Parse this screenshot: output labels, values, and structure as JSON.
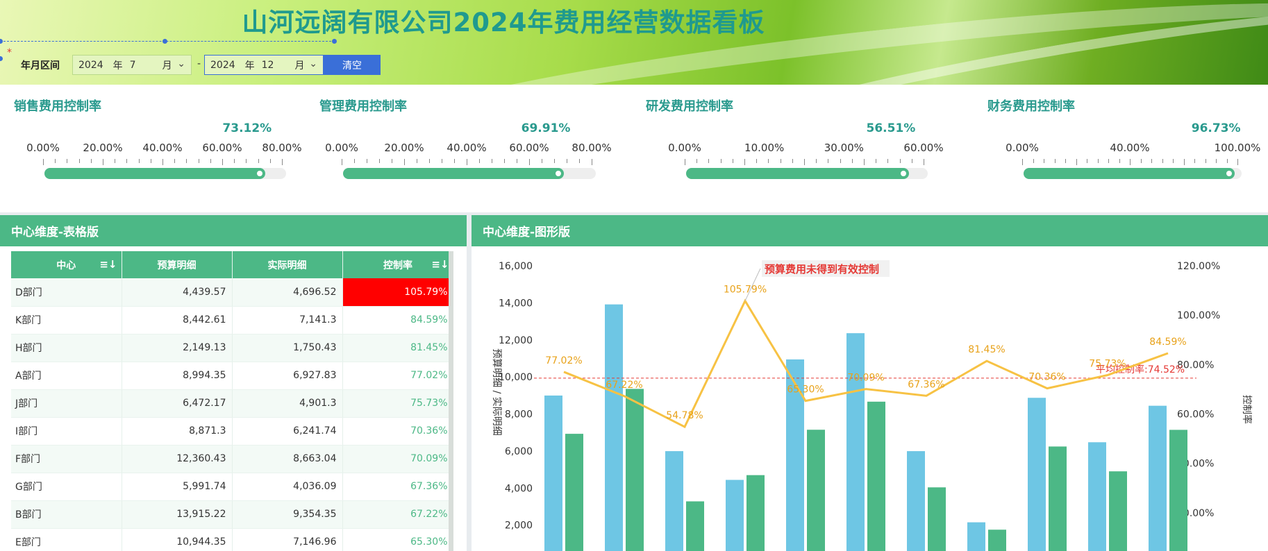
{
  "header": {
    "title": "山河远阔有限公司2024年费用经营数据看板",
    "filter_label": "年月区间",
    "required_mark": "*",
    "start": {
      "year": "2024",
      "year_unit": "年",
      "month": "7",
      "month_unit": "月"
    },
    "end": {
      "year": "2024",
      "year_unit": "年",
      "month": "12",
      "month_unit": "月"
    },
    "separator": "-",
    "clear_label": "清空",
    "chevron_icon": "chevron-down-icon"
  },
  "kpis": [
    {
      "title": "销售费用控制率",
      "value": "73.12%",
      "ratio": 0.914,
      "ticks": [
        "0.00%",
        "20.00%",
        "40.00%",
        "60.00%",
        "80.00%"
      ]
    },
    {
      "title": "管理费用控制率",
      "value": "69.91%",
      "ratio": 0.874,
      "ticks": [
        "0.00%",
        "20.00%",
        "40.00%",
        "60.00%",
        "80.00%"
      ]
    },
    {
      "title": "研发费用控制率",
      "value": "56.51%",
      "ratio": 0.923,
      "ticks": [
        "0.00%",
        "10.00%",
        "30.00%",
        "60.00%"
      ]
    },
    {
      "title": "财务费用控制率",
      "value": "96.73%",
      "ratio": 0.967,
      "ticks": [
        "0.00%",
        "40.00%",
        "100.00%"
      ]
    }
  ],
  "table_panel": {
    "title": "中心维度-表格版",
    "columns": [
      "中心",
      "预算明细",
      "实际明细",
      "控制率"
    ],
    "sort_icon": "sort-icon",
    "rows": [
      {
        "name": "D部门",
        "budget": "4,439.57",
        "actual": "4,696.52",
        "rate": "105.79%",
        "over": true
      },
      {
        "name": "K部门",
        "budget": "8,442.61",
        "actual": "7,141.3",
        "rate": "84.59%",
        "over": false
      },
      {
        "name": "H部门",
        "budget": "2,149.13",
        "actual": "1,750.43",
        "rate": "81.45%",
        "over": false
      },
      {
        "name": "A部门",
        "budget": "8,994.35",
        "actual": "6,927.83",
        "rate": "77.02%",
        "over": false
      },
      {
        "name": "J部门",
        "budget": "6,472.17",
        "actual": "4,901.3",
        "rate": "75.73%",
        "over": false
      },
      {
        "name": "I部门",
        "budget": "8,871.3",
        "actual": "6,241.74",
        "rate": "70.36%",
        "over": false
      },
      {
        "name": "F部门",
        "budget": "12,360.43",
        "actual": "8,663.04",
        "rate": "70.09%",
        "over": false
      },
      {
        "name": "G部门",
        "budget": "5,991.74",
        "actual": "4,036.09",
        "rate": "67.36%",
        "over": false
      },
      {
        "name": "B部门",
        "budget": "13,915.22",
        "actual": "9,354.35",
        "rate": "67.22%",
        "over": false
      },
      {
        "name": "E部门",
        "budget": "10,944.35",
        "actual": "7,146.96",
        "rate": "65.30%",
        "over": false
      }
    ]
  },
  "chart_panel": {
    "title": "中心维度-图形版"
  },
  "chart_data": {
    "type": "bar",
    "ylabel": "预算明细 / 实际明细",
    "y2label": "控制率",
    "yticks": [
      "2,000",
      "4,000",
      "6,000",
      "8,000",
      "10,000",
      "12,000",
      "14,000",
      "16,000"
    ],
    "y2ticks": [
      "20.00%",
      "40.00%",
      "60.00%",
      "80.00%",
      "100.00%",
      "120.00%"
    ],
    "ylim": [
      0,
      16000
    ],
    "y2lim": [
      0,
      120
    ],
    "budget": [
      8994.35,
      13915.22,
      5991.74,
      4439.57,
      10944.35,
      12360.43,
      5991.74,
      2149.13,
      8871.3,
      6472.17,
      8442.61
    ],
    "actual": [
      6927.83,
      9354.35,
      3280,
      4696.52,
      7146.96,
      8663.04,
      4036.09,
      1750.43,
      6241.74,
      4901.3,
      7141.3
    ],
    "rates": [
      77.02,
      67.22,
      54.78,
      105.79,
      65.3,
      70.09,
      67.36,
      81.45,
      70.36,
      75.73,
      84.59
    ],
    "rate_labels": [
      "77.02%",
      "67.22%",
      "54.78%",
      "105.79%",
      "65.30%",
      "70.09%",
      "67.36%",
      "81.45%",
      "70.36%",
      "75.73%",
      "84.59%"
    ],
    "average_rate": 74.52,
    "average_label": "平均控制率:74.52%",
    "annotation": "预算费用未得到有效控制",
    "colors": {
      "budget": "#6ec6e4",
      "actual": "#4cb886",
      "rate": "#f7c244",
      "average": "#e53935",
      "label": "#e8a21a"
    }
  }
}
